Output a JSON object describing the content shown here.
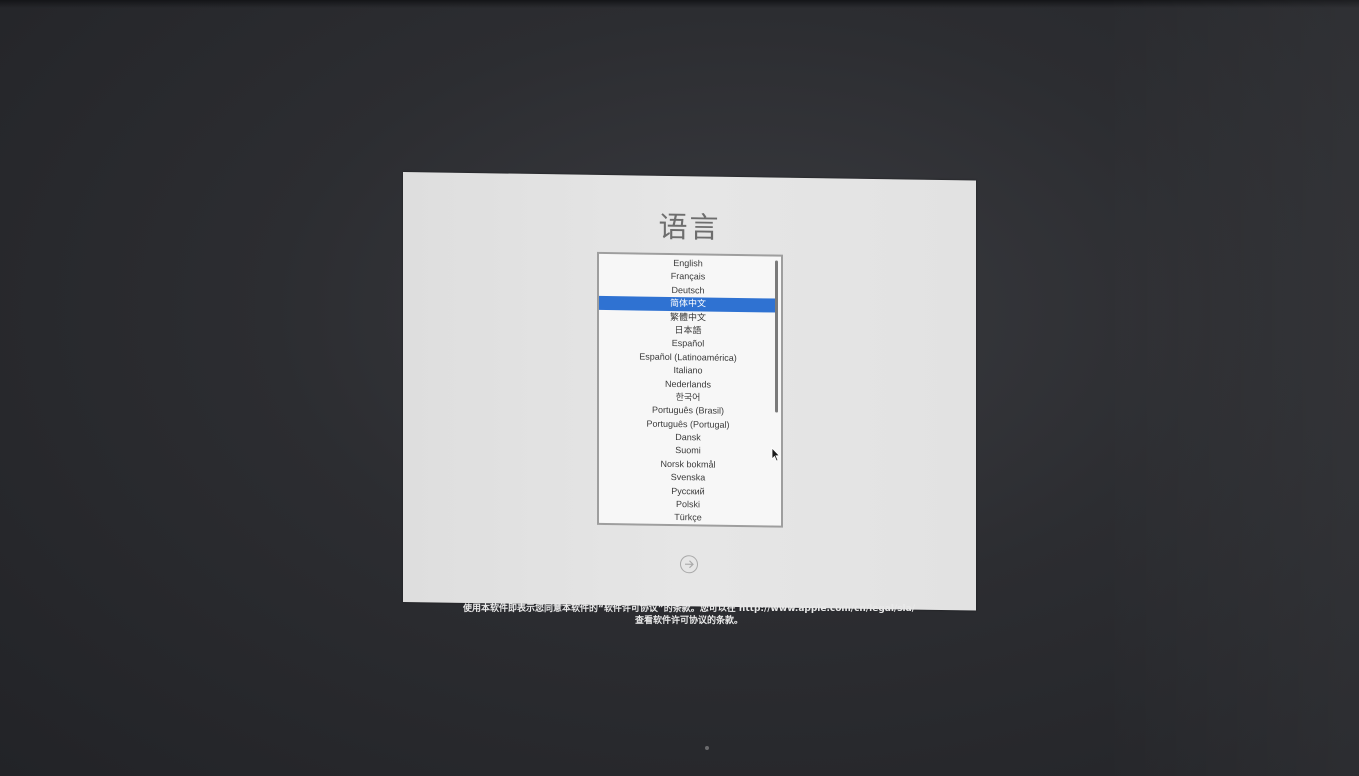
{
  "installer": {
    "title": "语言",
    "languages": [
      "English",
      "Français",
      "Deutsch",
      "简体中文",
      "繁體中文",
      "日本語",
      "Español",
      "Español (Latinoamérica)",
      "Italiano",
      "Nederlands",
      "한국어",
      "Português (Brasil)",
      "Português (Portugal)",
      "Dansk",
      "Suomi",
      "Norsk bokmål",
      "Svenska",
      "Русский",
      "Polski",
      "Türkçe"
    ],
    "selected_language": "简体中文",
    "next_button_icon": "arrow-right-circle-icon"
  },
  "legal": {
    "line1": "使用本软件即表示您同意本软件的“软件许可协议”的条款。您可以在 http://www.apple.com/cn/legal/sla/",
    "line2": "查看软件许可协议的条款。"
  },
  "colors": {
    "selection": "#2f72d2",
    "panel": "#e3e3e3",
    "background": "#2c2d31"
  }
}
